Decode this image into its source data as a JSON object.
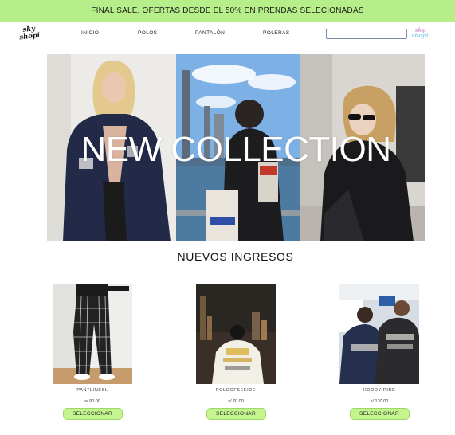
{
  "promo": {
    "text": "FINAL SALE, OFERTAS DESDE EL 50% EN PRENDAS SELECIONADAS"
  },
  "header": {
    "logo_top": "sky",
    "logo_bottom": "shopi",
    "nav": [
      {
        "label": "INICIO"
      },
      {
        "label": "POLOS"
      },
      {
        "label": "PANTALÓN"
      },
      {
        "label": "POLERAS"
      }
    ],
    "search": {
      "value": "",
      "placeholder": ""
    },
    "cart_logo_top": "sky",
    "cart_logo_bottom": "shopi"
  },
  "hero": {
    "title": "NEW COLLECTION"
  },
  "section": {
    "title": "NUEVOS INGRESOS"
  },
  "products": [
    {
      "name": "PANTLINESL",
      "price": "s/ 90.00",
      "button": "SELECCIONAR"
    },
    {
      "name": "POLOOFSEEIDE",
      "price": "s/ 70.00",
      "button": "SELECCIONAR"
    },
    {
      "name": "HOODY RIDE",
      "price": "s/ 130.00",
      "button": "SELECCIONAR"
    }
  ],
  "colors": {
    "promo_bg": "#b6ef8a",
    "button_bg": "#c4f58f"
  }
}
